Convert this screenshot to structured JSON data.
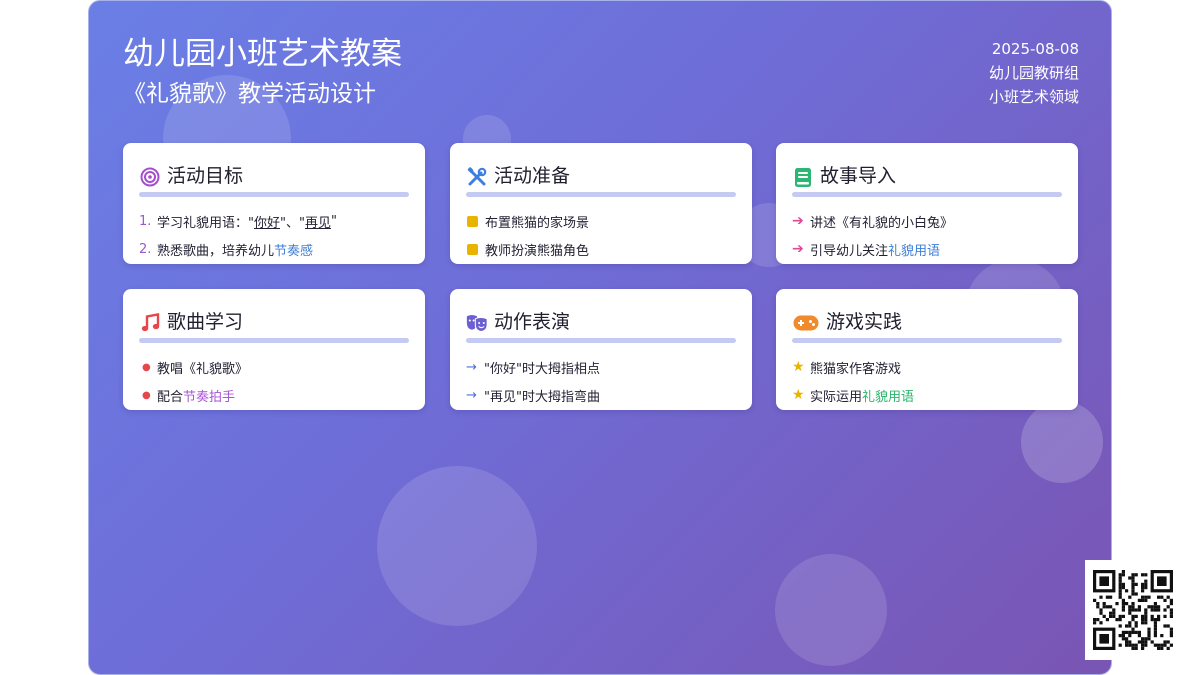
{
  "header": {
    "title": "幼儿园小班艺术教案",
    "subtitle": "《礼貌歌》教学活动设计"
  },
  "meta": {
    "date": "2025-08-08",
    "author": "幼儿园教研组",
    "domain": "小班艺术领域"
  },
  "cards": {
    "goals": {
      "icon": "target-icon",
      "title": "活动目标",
      "item1": {
        "marker": "1.",
        "prefix": "学习礼貌用语：\"",
        "w1": "你好",
        "mid": "\"、\"",
        "w2": "再见",
        "suffix": "\""
      },
      "item2": {
        "marker": "2.",
        "prefix": "熟悉歌曲，培养幼儿",
        "highlight": "节奏感"
      }
    },
    "prep": {
      "icon": "tools-icon",
      "title": "活动准备",
      "items": [
        "布置熊猫的家场景",
        "教师扮演熊猫角色"
      ]
    },
    "story": {
      "icon": "book-icon",
      "title": "故事导入",
      "item1": "讲述《有礼貌的小白兔》",
      "item2": {
        "prefix": "引导幼儿关注",
        "highlight": "礼貌用语"
      }
    },
    "song": {
      "icon": "music-note-icon",
      "title": "歌曲学习",
      "item1": "教唱《礼貌歌》",
      "item2": {
        "prefix": "配合",
        "highlight": "节奏拍手"
      }
    },
    "action": {
      "icon": "theater-masks-icon",
      "title": "动作表演",
      "items": [
        "\"你好\"时大拇指相点",
        "\"再见\"时大拇指弯曲"
      ]
    },
    "game": {
      "icon": "gamepad-icon",
      "title": "游戏实践",
      "item1": "熊猫家作客游戏",
      "item2": {
        "prefix": "实际运用",
        "highlight": "礼貌用语"
      }
    }
  },
  "colors": {
    "gradient_start": "#6a7fe6",
    "gradient_end": "#7a55b3",
    "card_bar": "#c5caf2",
    "highlight_blue": "#3f7fd6",
    "highlight_purple": "#a855d8",
    "highlight_green": "#2ab56a"
  }
}
